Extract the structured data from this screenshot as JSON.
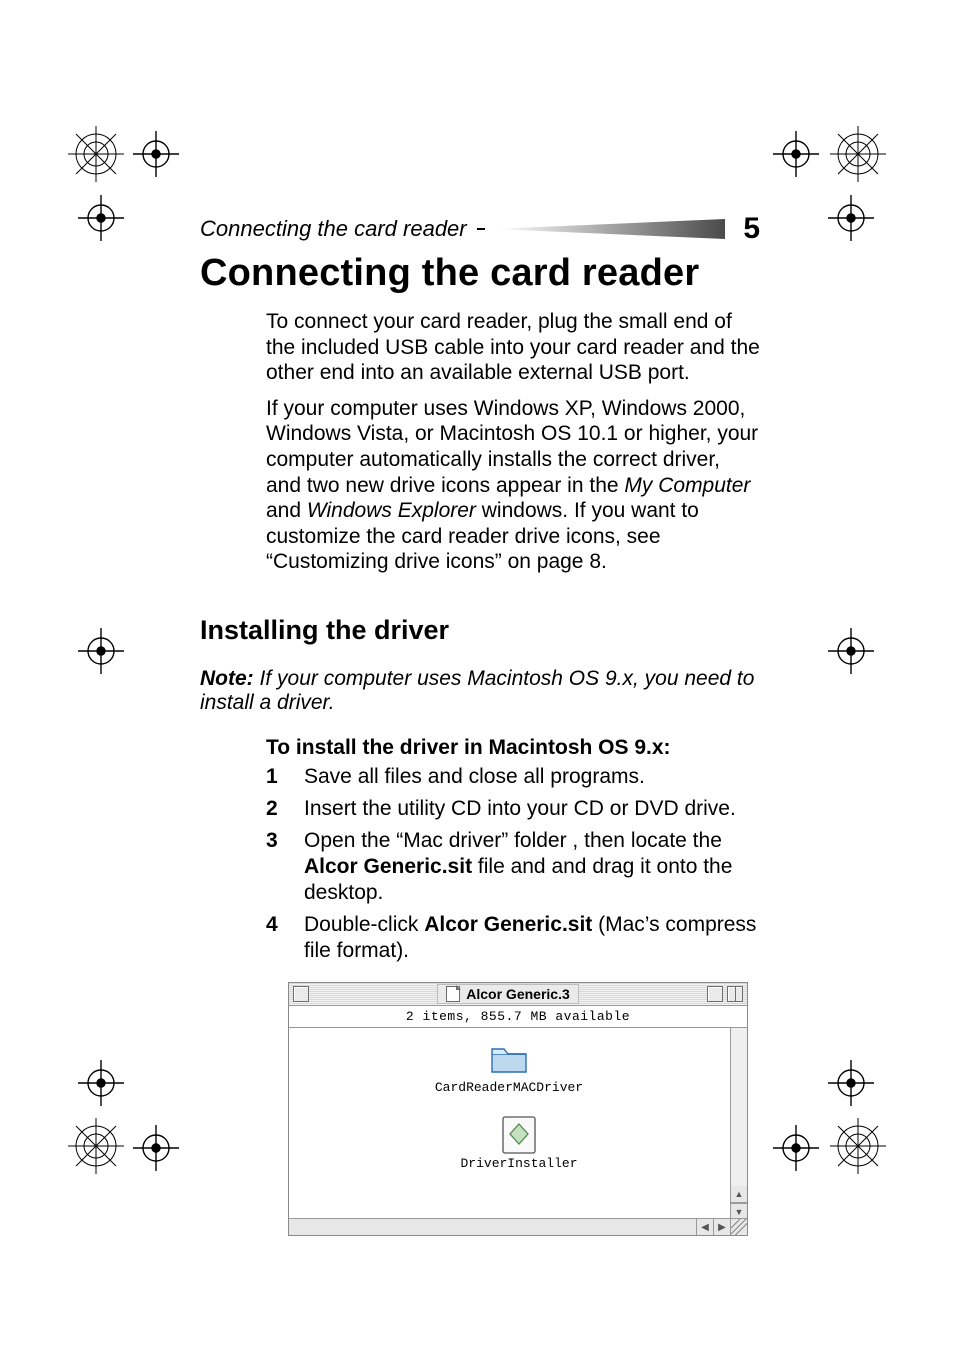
{
  "page_number": "5",
  "running_head": "Connecting the card reader",
  "heading": "Connecting the card reader",
  "intro_paragraphs": {
    "p1": "To connect your card reader, plug the small end of the included USB cable into your card reader and the other end into an available external USB port.",
    "p2_pre": "If your computer uses Windows XP, Windows 2000, Windows Vista, or Macintosh OS 10.1 or higher, your computer automatically installs the correct driver, and two new drive icons appear in the ",
    "p2_i1": "My Computer",
    "p2_mid": " and ",
    "p2_i2": "Windows Explorer",
    "p2_post": " windows. If you want to customize the card reader drive icons, see “Customizing drive icons” on page 8."
  },
  "subheading": "Installing the driver",
  "note": {
    "label": "Note:",
    "text": " If your computer uses Macintosh OS 9.x, you need to install a driver."
  },
  "instructions_heading": "To install the driver in Macintosh OS 9.x:",
  "steps": [
    {
      "n": "1",
      "pre": "Save all files and close all programs."
    },
    {
      "n": "2",
      "pre": "Insert the utility CD into your CD or DVD drive."
    },
    {
      "n": "3",
      "pre": "Open the “Mac driver” folder , then locate the ",
      "bold": "Alcor Generic.sit",
      "post": " file and and drag it onto the desktop."
    },
    {
      "n": "4",
      "pre": "Double-click ",
      "bold": "Alcor Generic.sit",
      "post": " (Mac’s compress file format)."
    }
  ],
  "mac_window": {
    "title": "Alcor Generic.3",
    "status": "2 items, 855.7 MB available",
    "items": [
      {
        "kind": "folder",
        "label": "CardReaderMACDriver"
      },
      {
        "kind": "installer",
        "label": "DriverInstaller"
      }
    ]
  }
}
